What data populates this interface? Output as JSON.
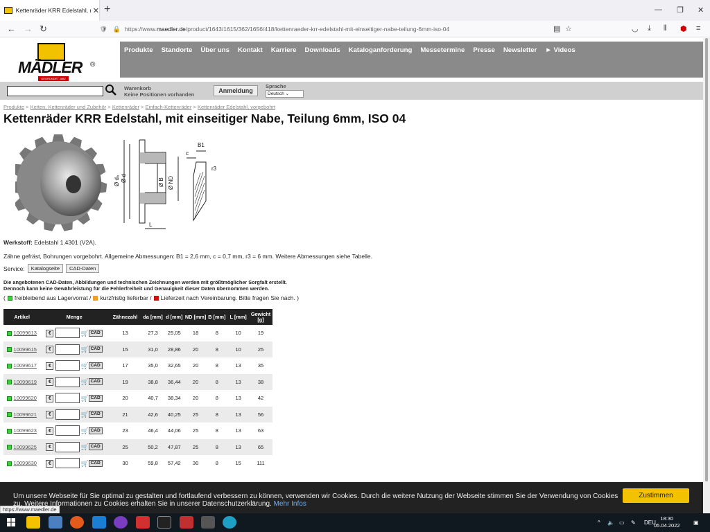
{
  "browser": {
    "tab_title": "Kettenräder KRR Edelstahl, mit",
    "url_prefix": "https://www.",
    "url_domain": "maedler.de",
    "url_path": "/product/1643/1615/362/1656/418/kettenraeder-krr-edelstahl-mit-einseitiger-nabe-teilung-6mm-iso-04",
    "status_url": "https://www.maedler.de"
  },
  "site": {
    "logo_text": "MÄDLER",
    "logo_tagline": "GEGRÜNDET 1882",
    "menu": [
      "Produkte",
      "Standorte",
      "Über uns",
      "Kontakt",
      "Karriere",
      "Downloads",
      "Kataloganforderung",
      "Messetermine",
      "Presse",
      "Newsletter",
      "► Videos"
    ],
    "cart_line1": "Warenkorb",
    "cart_line2": "Keine Positionen vorhanden",
    "login_label": "Anmeldung",
    "language_label": "Sprache",
    "language_value": "Deutsch"
  },
  "breadcrumb": {
    "home": "Produkte",
    "items": [
      "Ketten, Kettenräder und Zubehör",
      "Kettenräder",
      "Einfach-Kettenräder",
      "Kettenräder Edelstahl, vorgebohrt"
    ],
    "separator": ">"
  },
  "product": {
    "title": "Kettenräder KRR Edelstahl, mit einseitiger Nabe, Teilung 6mm, ISO 04",
    "material_label": "Werkstoff:",
    "material_value": "Edelstahl 1.4301 (V2A).",
    "description": "Zähne gefräst, Bohrungen vorgebohrt. Allgemeine Abmessungen: B1 = 2,6 mm, c = 0,7 mm, r3 = 6 mm. Weitere Abmessungen siehe Tabelle.",
    "service_label": "Service:",
    "service_buttons": [
      "Katalogseite",
      "CAD-Daten"
    ],
    "disclaimer_line1": "Die angebotenen CAD-Daten, Abbildungen und technischen Zeichnungen werden mit größtmöglicher Sorgfalt erstellt.",
    "disclaimer_line2": "Dennoch kann keine Gewährleistung für die Fehlerfreiheit und Genauigkeit dieser Daten übernommen werden.",
    "legend_open": "(",
    "legend_green": "freibleibend aus Lagervorrat /",
    "legend_orange": "kurzfristig lieferbar /",
    "legend_red": "Lieferzeit nach Vereinbarung. Bitte fragen Sie nach. )"
  },
  "drawing_labels": {
    "b1": "B1",
    "c": "c",
    "r3": "r3",
    "da": "Ø dₐ",
    "d": "Ø d",
    "b": "Ø B",
    "nd": "Ø ND",
    "l": "L"
  },
  "table": {
    "headers": [
      "Artikel",
      "Menge",
      "Zähnezahl",
      "da [mm]",
      "d [mm]",
      "ND [mm]",
      "B [mm]",
      "L [mm]",
      "Gewicht [g]"
    ],
    "cad_label": "CAD",
    "euro_label": "€",
    "rows": [
      {
        "artikel": "10099613",
        "z": "13",
        "da": "27,3",
        "d": "25,05",
        "nd": "18",
        "b": "8",
        "l": "10",
        "g": "19"
      },
      {
        "artikel": "10099615",
        "z": "15",
        "da": "31,0",
        "d": "28,86",
        "nd": "20",
        "b": "8",
        "l": "10",
        "g": "25"
      },
      {
        "artikel": "10099617",
        "z": "17",
        "da": "35,0",
        "d": "32,65",
        "nd": "20",
        "b": "8",
        "l": "13",
        "g": "35"
      },
      {
        "artikel": "10099619",
        "z": "19",
        "da": "38,8",
        "d": "36,44",
        "nd": "20",
        "b": "8",
        "l": "13",
        "g": "38"
      },
      {
        "artikel": "10099620",
        "z": "20",
        "da": "40,7",
        "d": "38,34",
        "nd": "20",
        "b": "8",
        "l": "13",
        "g": "42"
      },
      {
        "artikel": "10099621",
        "z": "21",
        "da": "42,6",
        "d": "40,25",
        "nd": "25",
        "b": "8",
        "l": "13",
        "g": "56"
      },
      {
        "artikel": "10099623",
        "z": "23",
        "da": "46,4",
        "d": "44,06",
        "nd": "25",
        "b": "8",
        "l": "13",
        "g": "63"
      },
      {
        "artikel": "10099625",
        "z": "25",
        "da": "50,2",
        "d": "47,87",
        "nd": "25",
        "b": "8",
        "l": "13",
        "g": "65"
      },
      {
        "artikel": "10099630",
        "z": "30",
        "da": "59,8",
        "d": "57,42",
        "nd": "30",
        "b": "8",
        "l": "15",
        "g": "111"
      }
    ]
  },
  "cookie": {
    "text": "Um unsere Webseite für Sie optimal zu gestalten und fortlaufend verbessern zu können, verwenden wir Cookies. Durch die weitere Nutzung der Webseite stimmen Sie der Verwendung von Cookies zu. Weitere Informationen zu Cookies erhalten Sie in unserer Datenschutzerklärung.",
    "more_link": "Mehr Infos",
    "accept_label": "Zustimmen"
  },
  "taskbar": {
    "lang": "DEU",
    "time": "18:30",
    "date": "05.04.2022"
  },
  "colors": {
    "menu_bg": "#8a8a8a",
    "brand_yellow": "#f2c200",
    "in_stock": "#3ad13a",
    "short_term": "#f0a020",
    "on_request": "#d01010"
  }
}
